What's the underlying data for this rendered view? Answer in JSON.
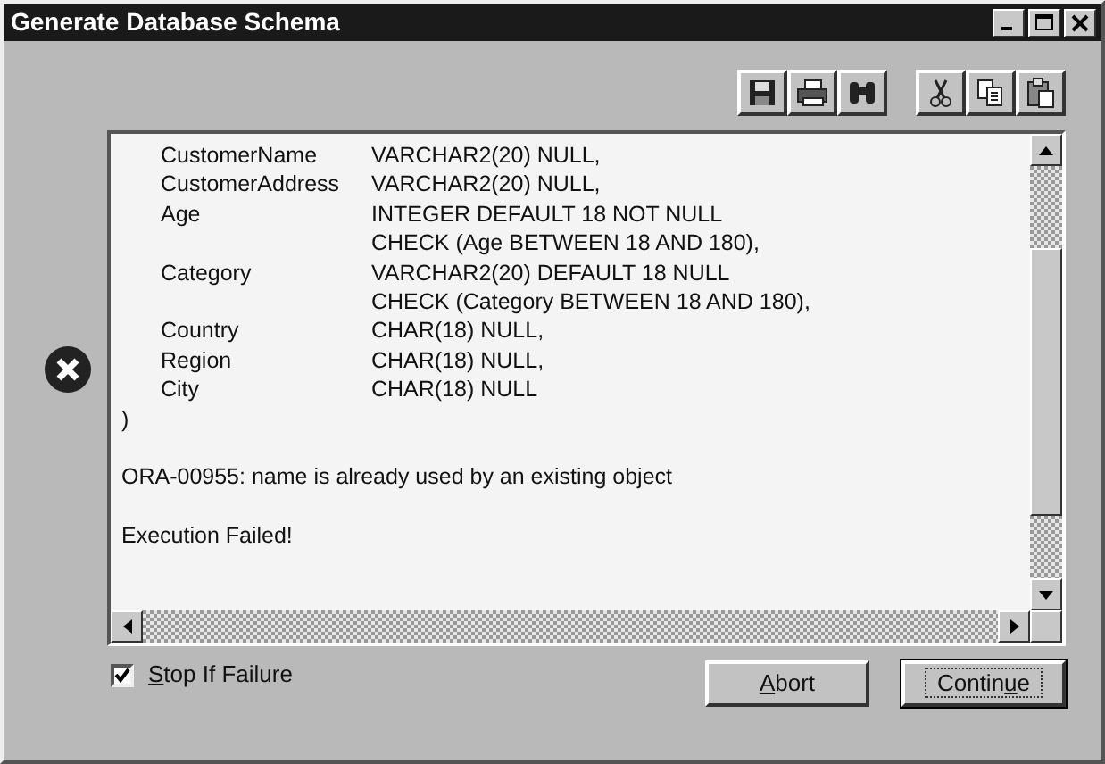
{
  "window": {
    "title": "Generate Database Schema"
  },
  "toolbar": [
    {
      "kind": "save"
    },
    {
      "kind": "print"
    },
    {
      "kind": "find"
    },
    {
      "kind": "cut"
    },
    {
      "kind": "copy"
    },
    {
      "kind": "paste"
    }
  ],
  "output": {
    "lines": [
      {
        "kind": "column",
        "name": "CustomerName",
        "definition": "VARCHAR2(20) NULL,"
      },
      {
        "kind": "column",
        "name": "CustomerAddress",
        "definition": "VARCHAR2(20) NULL,"
      },
      {
        "kind": "column",
        "name": "Age",
        "definition": "INTEGER DEFAULT 18 NOT NULL"
      },
      {
        "kind": "check",
        "definition": "CHECK (Age BETWEEN 18 AND 180),"
      },
      {
        "kind": "column",
        "name": "Category",
        "definition": "VARCHAR2(20) DEFAULT 18 NULL"
      },
      {
        "kind": "check",
        "definition": "CHECK (Category BETWEEN 18 AND 180),"
      },
      {
        "kind": "column",
        "name": "Country",
        "definition": "CHAR(18) NULL,"
      },
      {
        "kind": "column",
        "name": "Region",
        "definition": "CHAR(18) NULL,"
      },
      {
        "kind": "column",
        "name": "City",
        "definition": "CHAR(18) NULL"
      },
      {
        "kind": "plain",
        "text": ")"
      },
      {
        "kind": "gap"
      },
      {
        "kind": "plain",
        "text": "ORA-00955: name is already used by an existing object"
      },
      {
        "kind": "gap"
      },
      {
        "kind": "plain",
        "text": "Execution Failed!"
      }
    ]
  },
  "stop_if_failure": {
    "access_key": "S",
    "label_rest": "top If Failure",
    "checked": true
  },
  "buttons": [
    {
      "access_key": "A",
      "label_rest": "bort",
      "default": false
    },
    {
      "label_start": "Contin",
      "access_key": "u",
      "label_rest": "e",
      "default": true
    }
  ]
}
